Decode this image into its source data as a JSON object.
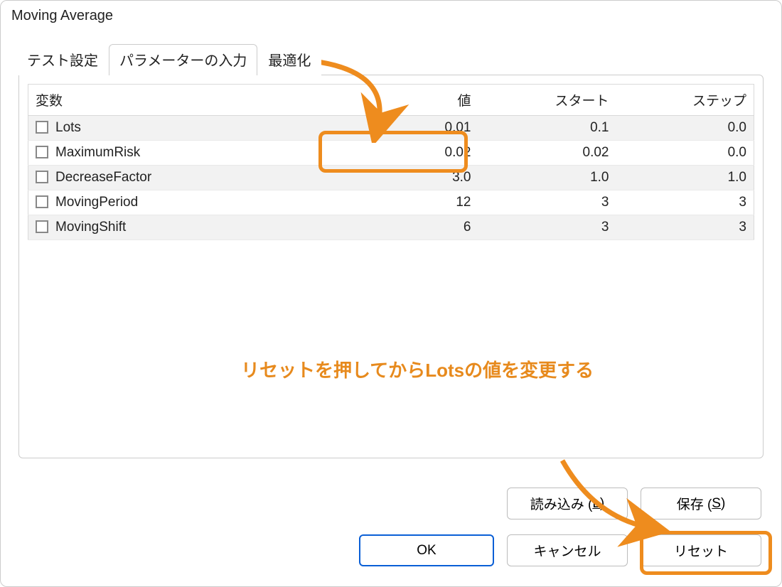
{
  "window": {
    "title": "Moving Average"
  },
  "tabs": {
    "test": "テスト設定",
    "params": "パラメーターの入力",
    "optimize": "最適化"
  },
  "table": {
    "headers": {
      "variable": "変数",
      "value": "値",
      "start": "スタート",
      "step": "ステップ"
    },
    "rows": [
      {
        "name": "Lots",
        "value": "0.01",
        "start": "0.1",
        "step": "0.0"
      },
      {
        "name": "MaximumRisk",
        "value": "0.02",
        "start": "0.02",
        "step": "0.0"
      },
      {
        "name": "DecreaseFactor",
        "value": "3.0",
        "start": "1.0",
        "step": "1.0"
      },
      {
        "name": "MovingPeriod",
        "value": "12",
        "start": "3",
        "step": "3"
      },
      {
        "name": "MovingShift",
        "value": "6",
        "start": "3",
        "step": "3"
      }
    ]
  },
  "annotation": {
    "text": "リセットを押してからLotsの値を変更する"
  },
  "buttons": {
    "load_pre": "読み込み (",
    "load_u": "L",
    "load_post": ")",
    "save_pre": "保存 (",
    "save_u": "S",
    "save_post": ")",
    "ok": "OK",
    "cancel": "キャンセル",
    "reset": "リセット"
  }
}
